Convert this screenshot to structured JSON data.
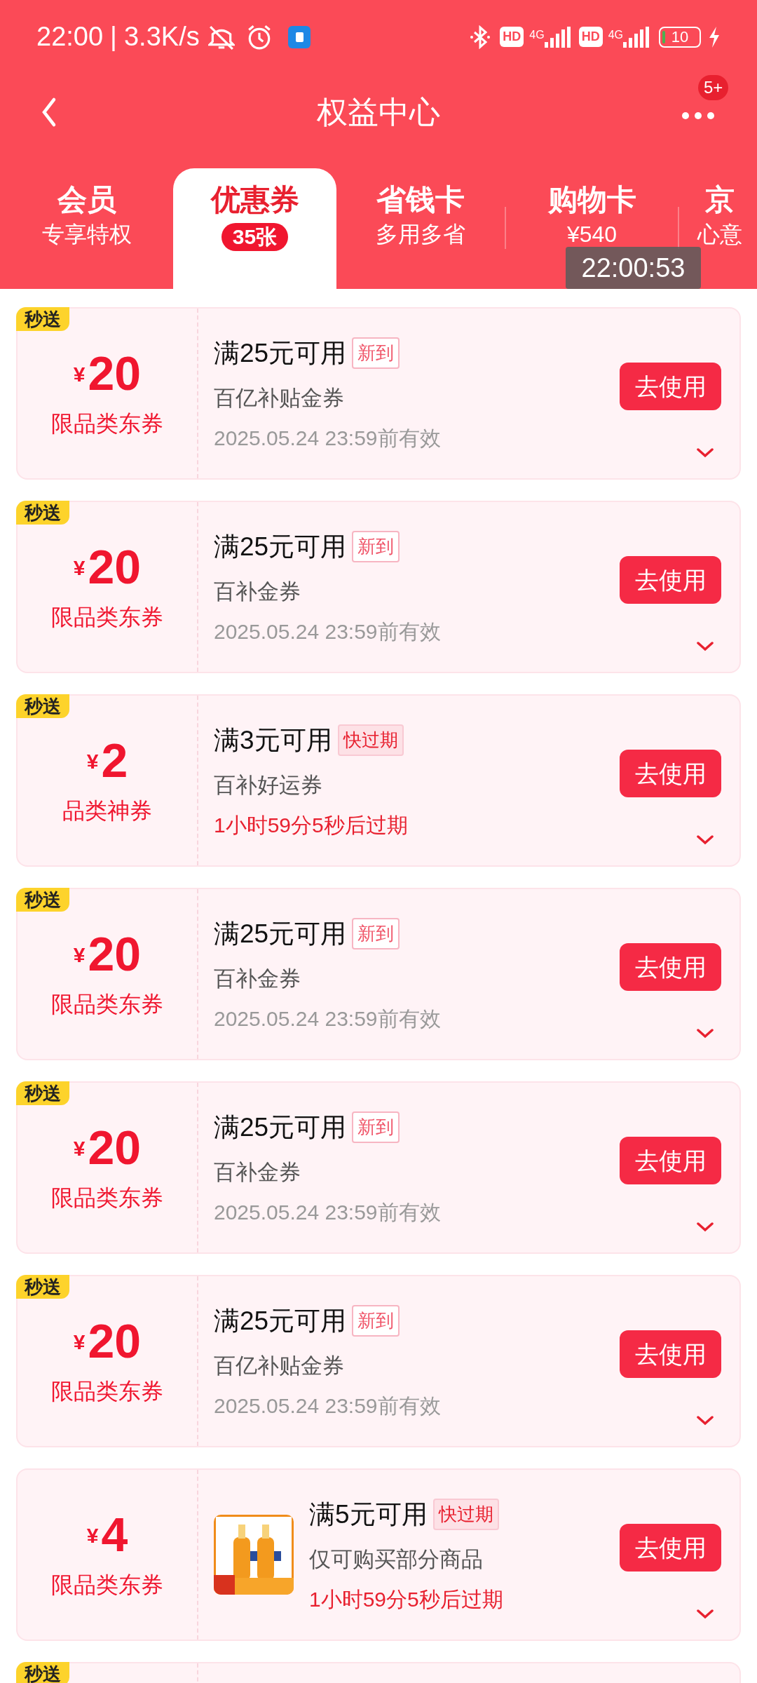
{
  "status_bar": {
    "time": "22:00",
    "separator": "|",
    "speed": "3.3K/s",
    "hd_1": "HD",
    "net_1": "4G",
    "hd_2": "HD",
    "net_2": "4G",
    "battery": "10"
  },
  "nav": {
    "title": "权益中心",
    "badge": "5+"
  },
  "tabs": [
    {
      "title": "会员",
      "subtitle": "专享特权",
      "selected": false
    },
    {
      "title": "优惠券",
      "subtitle": "35张",
      "selected": true
    },
    {
      "title": "省钱卡",
      "subtitle": "多用多省",
      "selected": false
    },
    {
      "title": "购物卡",
      "subtitle": "¥540",
      "selected": false
    },
    {
      "title": "京",
      "subtitle": "心意",
      "selected": false
    }
  ],
  "clock_overlay": "22:00:53",
  "coupons": [
    {
      "badge": "秒送",
      "currency": "¥",
      "amount": "20",
      "category": "限品类东券",
      "title": "满25元可用",
      "tag": "新到",
      "expiring": false,
      "subtitle": "百亿补贴金券",
      "validity": "2025.05.24 23:59前有效",
      "button": "去使用"
    },
    {
      "badge": "秒送",
      "currency": "¥",
      "amount": "20",
      "category": "限品类东券",
      "title": "满25元可用",
      "tag": "新到",
      "expiring": false,
      "subtitle": "百补金券",
      "validity": "2025.05.24 23:59前有效",
      "button": "去使用"
    },
    {
      "badge": "秒送",
      "currency": "¥",
      "amount": "2",
      "category": "品类神券",
      "title": "满3元可用",
      "tag": "快过期",
      "expiring": true,
      "subtitle": "百补好运券",
      "validity": "1小时59分5秒后过期",
      "button": "去使用"
    },
    {
      "badge": "秒送",
      "currency": "¥",
      "amount": "20",
      "category": "限品类东券",
      "title": "满25元可用",
      "tag": "新到",
      "expiring": false,
      "subtitle": "百补金券",
      "validity": "2025.05.24 23:59前有效",
      "button": "去使用"
    },
    {
      "badge": "秒送",
      "currency": "¥",
      "amount": "20",
      "category": "限品类东券",
      "title": "满25元可用",
      "tag": "新到",
      "expiring": false,
      "subtitle": "百补金券",
      "validity": "2025.05.24 23:59前有效",
      "button": "去使用"
    },
    {
      "badge": "秒送",
      "currency": "¥",
      "amount": "20",
      "category": "限品类东券",
      "title": "满25元可用",
      "tag": "新到",
      "expiring": false,
      "subtitle": "百亿补贴金券",
      "validity": "2025.05.24 23:59前有效",
      "button": "去使用"
    },
    {
      "currency": "¥",
      "amount": "4",
      "category": "限品类东券",
      "title": "满5元可用",
      "tag": "快过期",
      "expiring": true,
      "subtitle": "仅可购买部分商品",
      "validity": "1小时59分5秒后过期",
      "button": "去使用"
    },
    {
      "badge": "秒送"
    }
  ]
}
